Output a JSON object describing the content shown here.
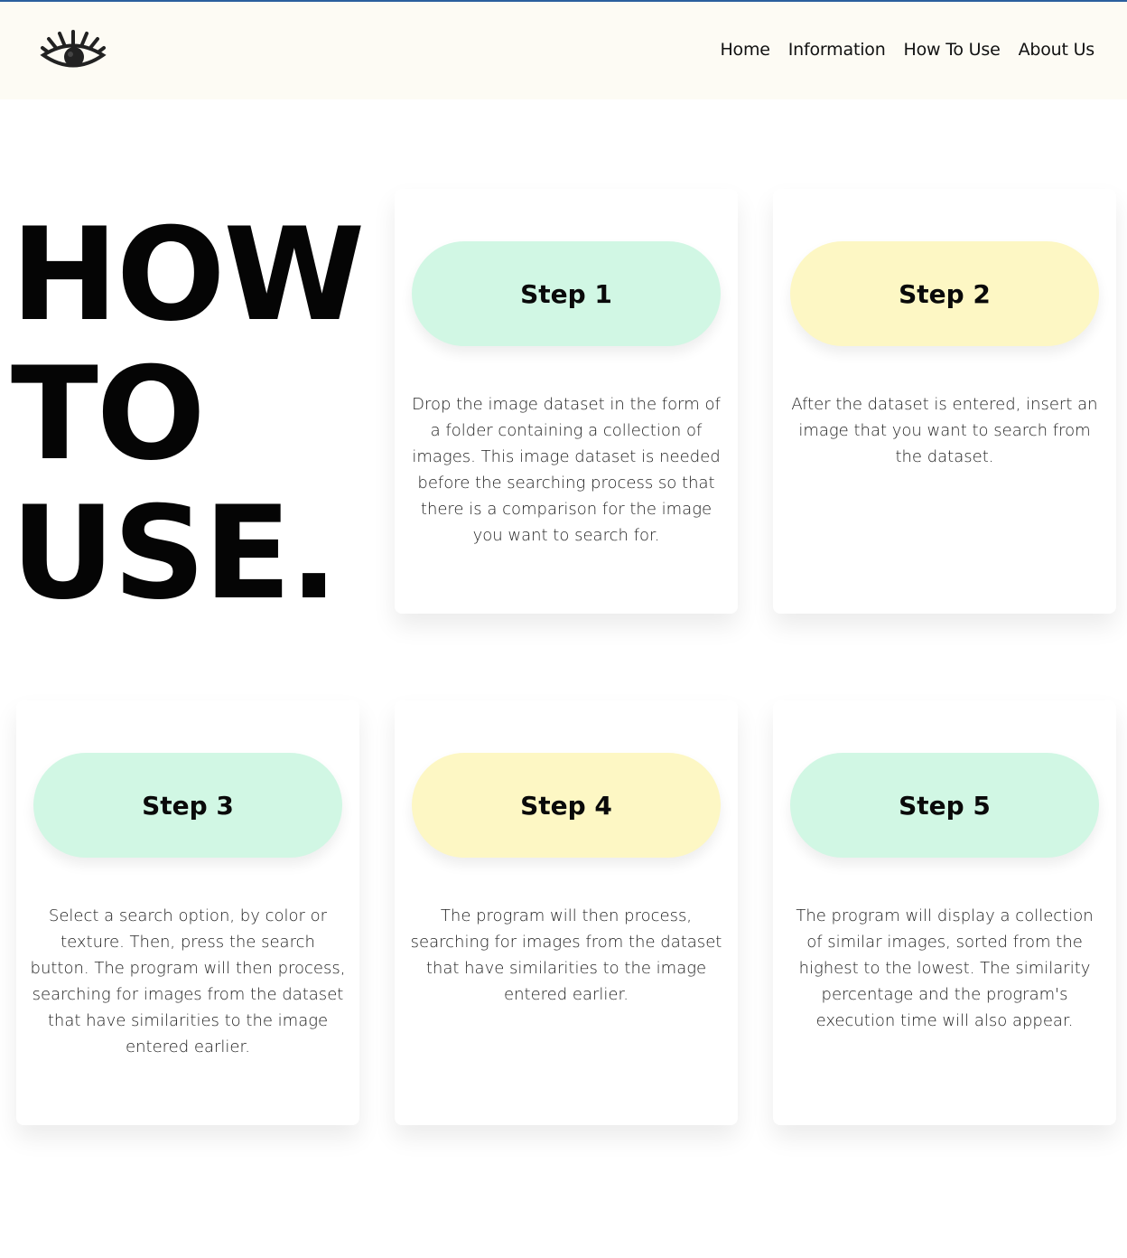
{
  "nav": {
    "logo_icon": "eye-icon",
    "links": [
      "Home",
      "Information",
      "How To Use",
      "About Us"
    ]
  },
  "hero": {
    "lines": [
      "HOW",
      "TO",
      "USE."
    ]
  },
  "colors": {
    "mint": "#d1f7e4",
    "yellow": "#fdf7c4",
    "navbar_bg": "#fdfbf4",
    "accent_line": "#2a5f9e"
  },
  "steps": [
    {
      "title": "Step 1",
      "text": "Drop the image dataset in the form of a folder containing a collection of images. This image dataset is needed before the searching process so that there is a comparison for the image you want to search for."
    },
    {
      "title": "Step 2",
      "text": "After the dataset is entered, insert an image that you want to search from the dataset."
    },
    {
      "title": "Step 3",
      "text": "Select a search option, by color or texture. Then, press the search button. The program will then process, searching for images from the dataset that have similarities to the image entered earlier."
    },
    {
      "title": "Step 4",
      "text": "The program will then process, searching for images from the dataset that have similarities to the image entered earlier."
    },
    {
      "title": "Step 5",
      "text": "The program will display a collection of similar images, sorted from the highest to the lowest. The similarity percentage and the program's execution time will also appear."
    }
  ]
}
